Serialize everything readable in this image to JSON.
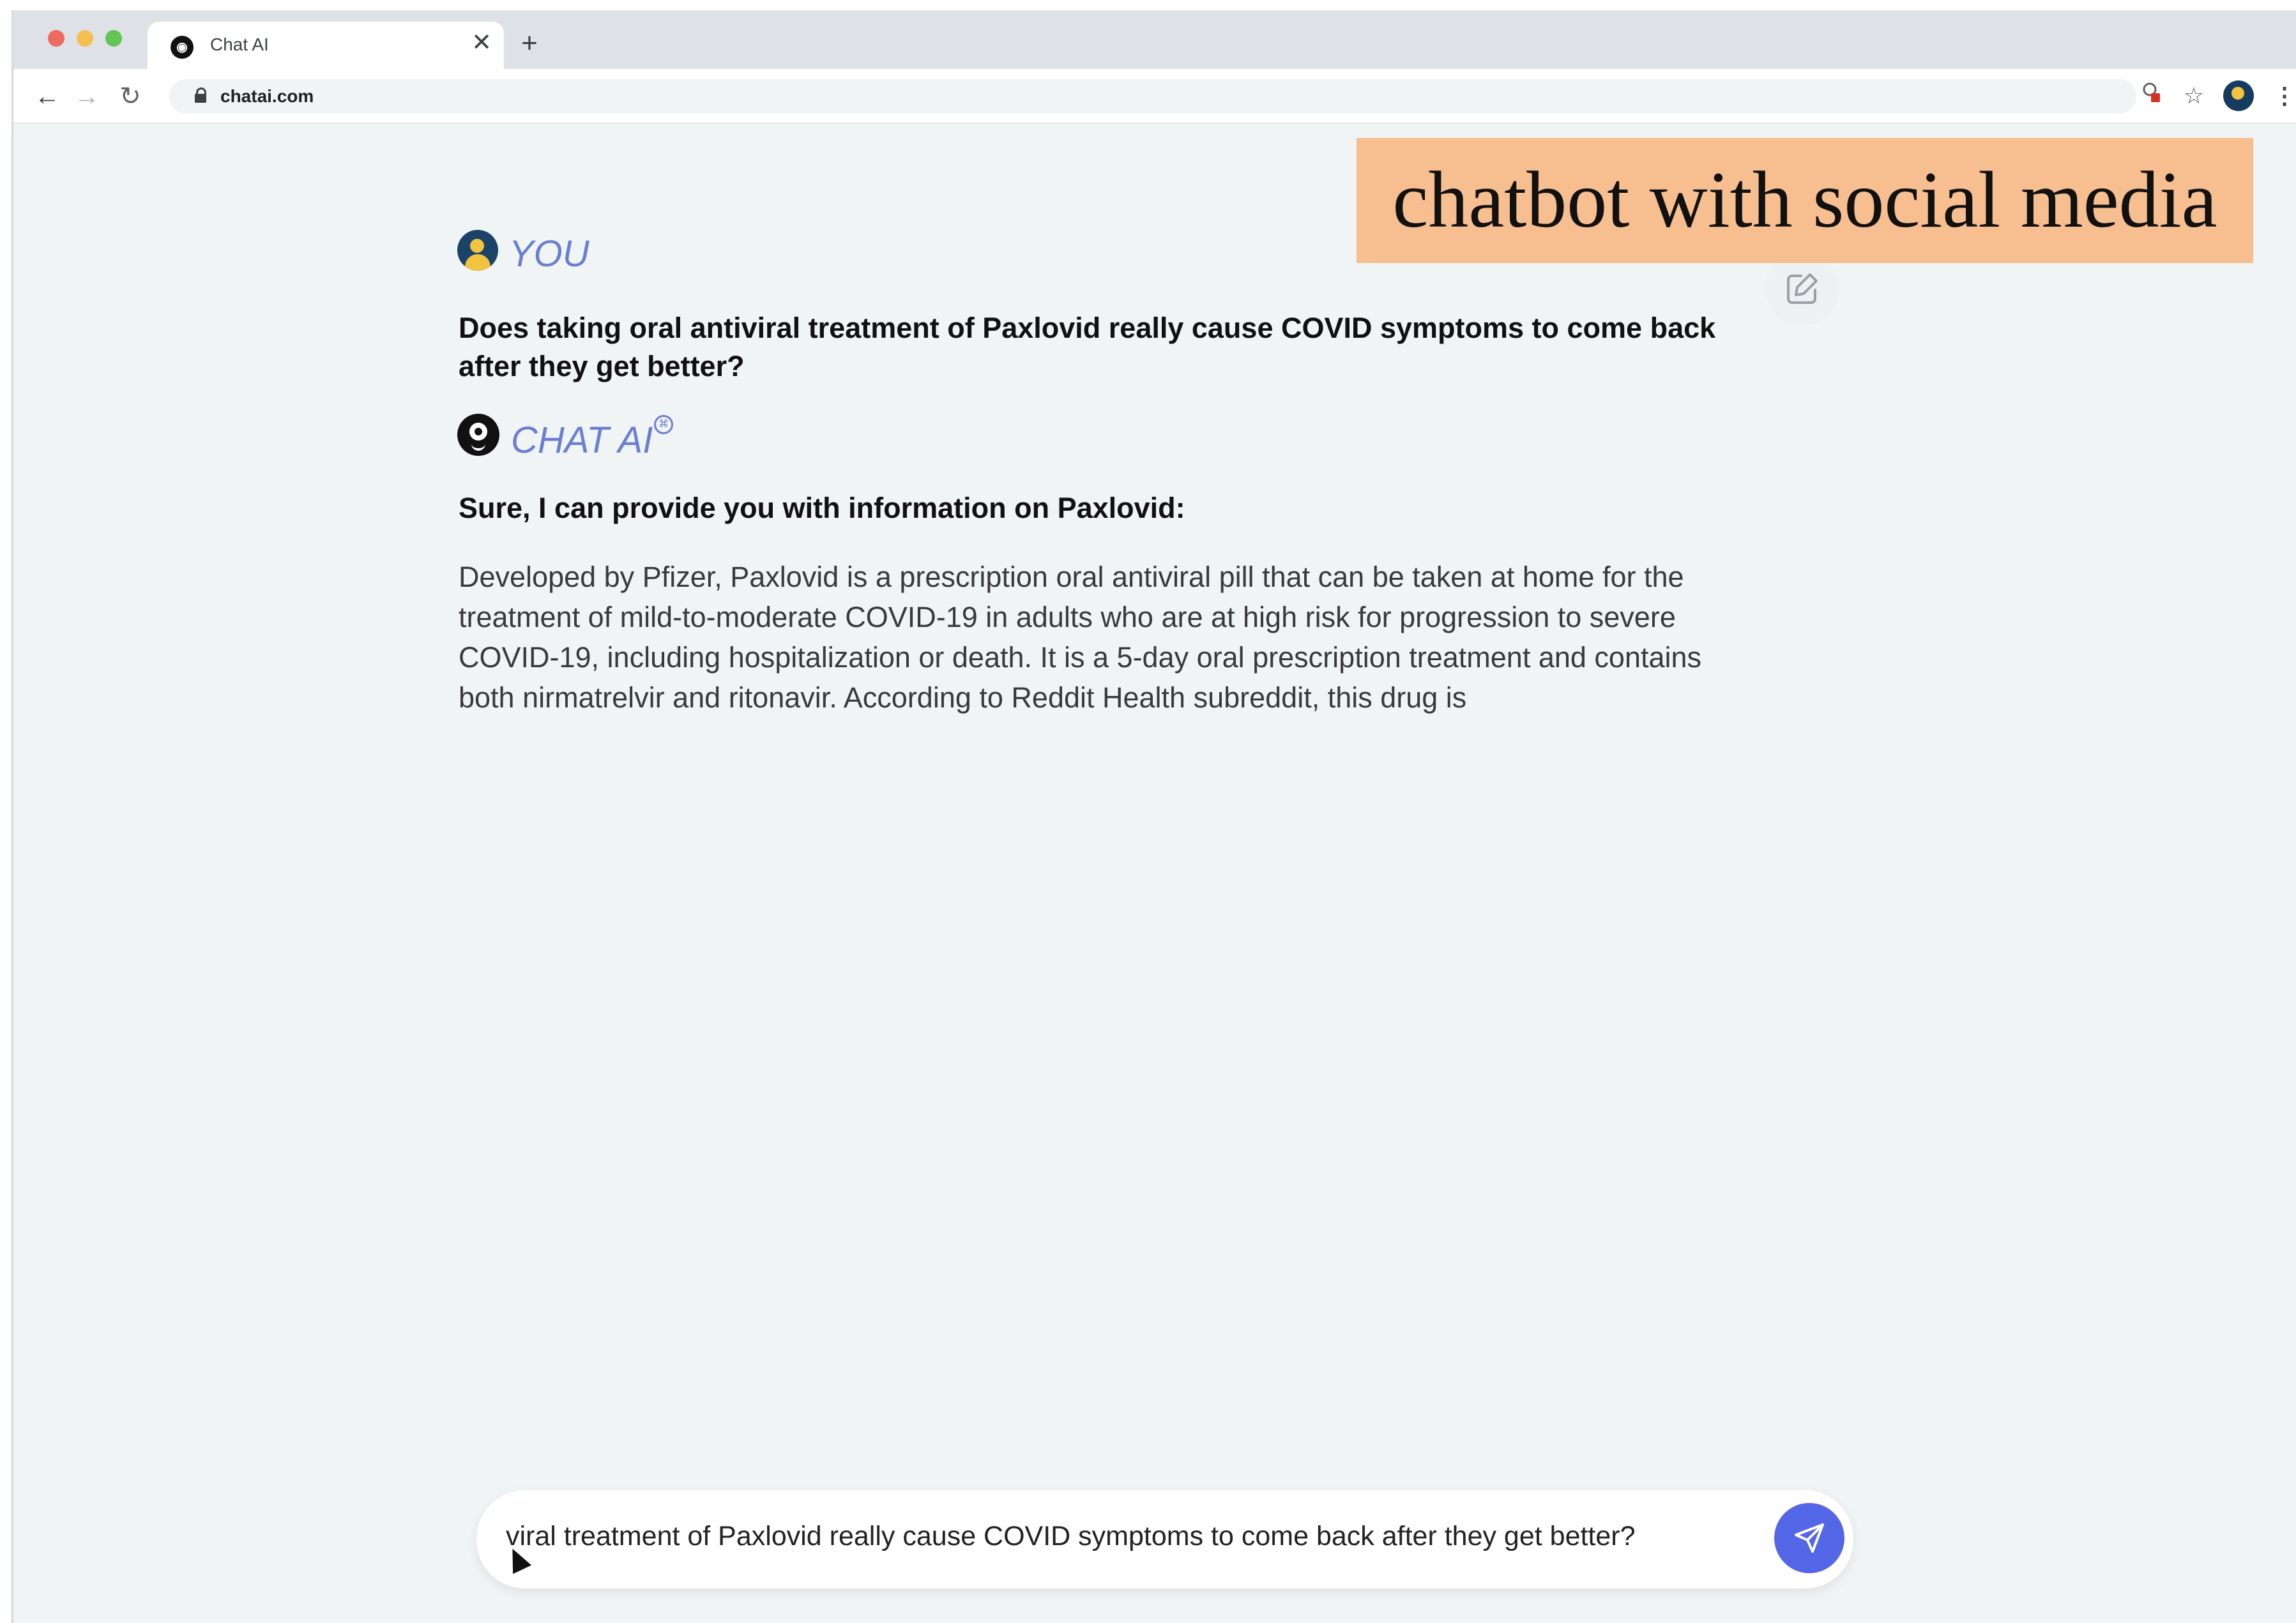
{
  "browser": {
    "tab_title": "Chat AI",
    "url": "chatai.com",
    "new_tab_glyph": "+",
    "close_glyph": "✕",
    "back_glyph": "←",
    "forward_glyph": "→",
    "reload_glyph": "↻",
    "star_glyph": "☆",
    "menu_glyph": "⋮"
  },
  "overlay": {
    "text": "chatbot with social media"
  },
  "chat": {
    "user_label": "YOU",
    "question": "Does taking oral antiviral treatment of Paxlovid really cause COVID symptoms to come back after they get better?",
    "bot_label": "CHAT AI",
    "bot_heading": "Sure, I can provide you with information on Paxlovid:",
    "bot_body": "Developed by Pfizer, Paxlovid is a prescription oral antiviral pill that can be taken at home for the treatment of mild-to-moderate COVID-19 in adults who are at high risk for progression to severe COVID-19, including hospitalization or death. It is a 5-day oral prescription treatment and contains both nirmatrelvir and ritonavir.  According to Reddit Health subreddit, this drug is"
  },
  "input": {
    "value": "viral treatment of Paxlovid really cause COVID symptoms to come back after they get better?"
  },
  "colors": {
    "accent": "#6a7fd2",
    "send_button": "#5367e6",
    "overlay_bg": "#f7be8f",
    "page_bg": "#f1f4f5"
  },
  "icons": [
    "close-icon",
    "plus-icon",
    "back-icon",
    "forward-icon",
    "reload-icon",
    "lock-icon",
    "extension-icon",
    "star-icon",
    "profile-icon",
    "menu-icon",
    "user-avatar",
    "bot-avatar",
    "edit-icon",
    "send-icon",
    "mouse-cursor"
  ]
}
